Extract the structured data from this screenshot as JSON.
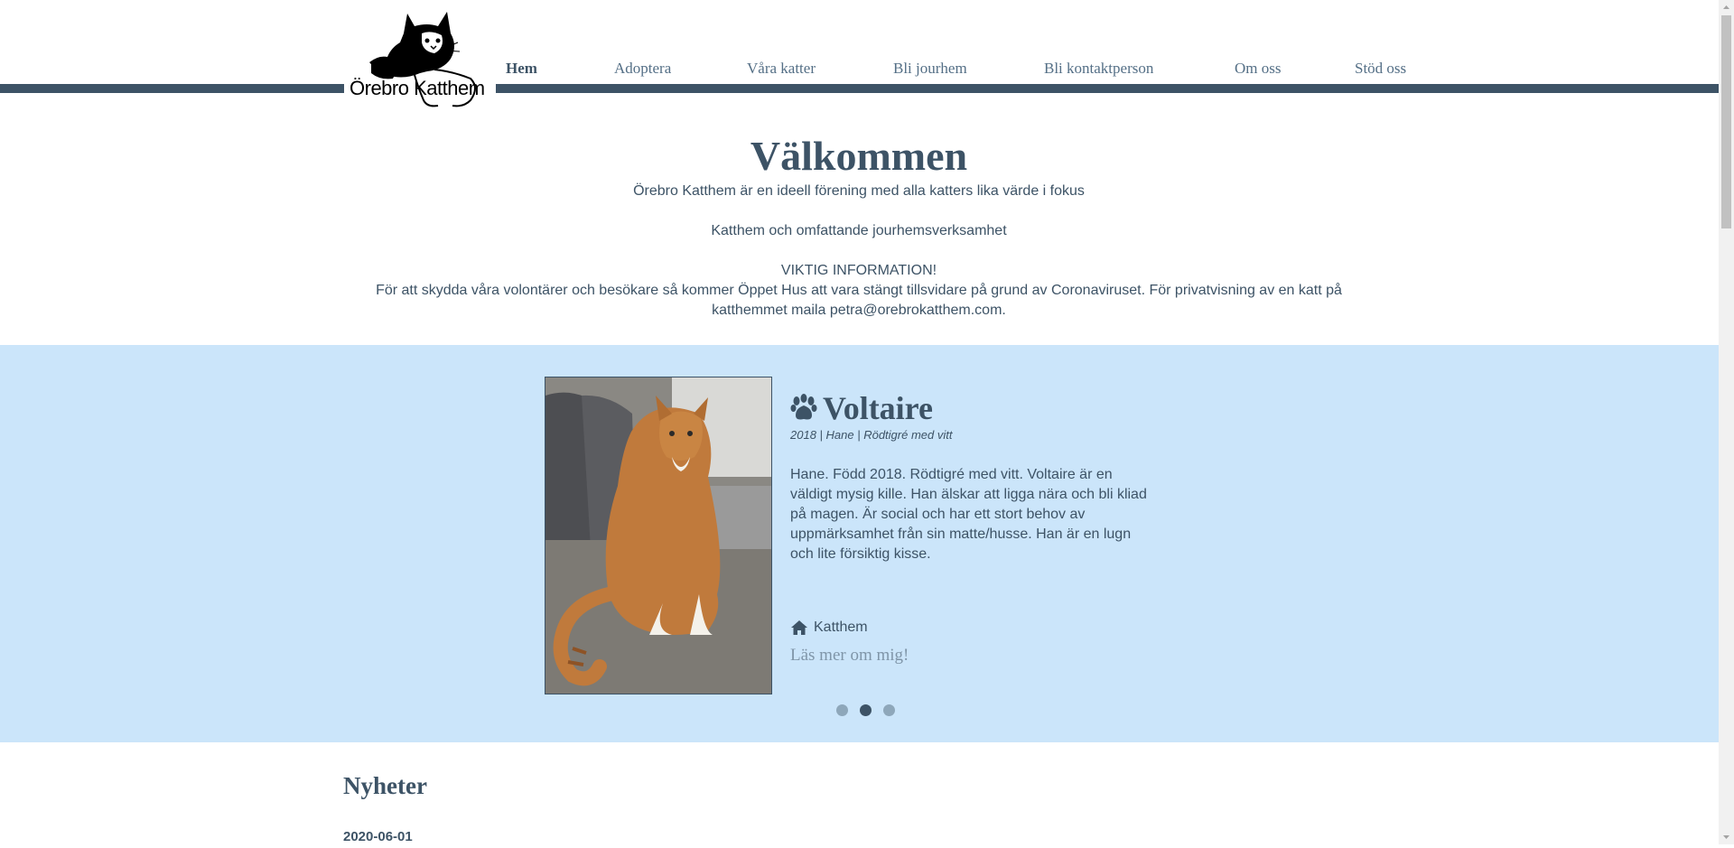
{
  "header": {
    "logo_text": "Örebro Katthem",
    "nav": [
      {
        "label": "Hem",
        "active": true
      },
      {
        "label": "Adoptera",
        "active": false
      },
      {
        "label": "Våra katter",
        "active": false
      },
      {
        "label": "Bli jourhem",
        "active": false
      },
      {
        "label": "Bli kontaktperson",
        "active": false
      },
      {
        "label": "Om oss",
        "active": false
      },
      {
        "label": "Stöd oss",
        "active": false
      }
    ]
  },
  "welcome": {
    "title": "Välkommen",
    "line1": "Örebro Katthem är en ideell förening med alla katters lika värde i fokus",
    "line2": "Katthem och omfattande jourhemsverksamhet",
    "line3": "VIKTIG INFORMATION!",
    "line4": "För att skydda våra volontärer och besökare så kommer Öppet Hus att vara stängt tillsvidare på grund av Coronaviruset. För privatvisning av en katt på katthemmet maila petra@orebrokatthem.com."
  },
  "slider": {
    "cat_name": "Voltaire",
    "cat_meta": "2018 | Hane | Rödtigré med vitt",
    "cat_description": "Hane. Född 2018. Rödtigré med vitt. Voltaire är en väldigt mysig kille. Han älskar att ligga nära och bli kliad på magen. Är social och har ett stort behov av uppmärksamhet från sin matte/husse. Han är en lugn och lite försiktig kisse.",
    "location": "Katthem",
    "read_more": "Läs mer om mig!",
    "dots": [
      false,
      true,
      false
    ]
  },
  "news": {
    "title": "Nyheter",
    "date": "2020-06-01"
  },
  "colors": {
    "primary": "#3d5366",
    "slider_bg": "#cbe5fa",
    "link_muted": "#7f95a8"
  },
  "icons": {
    "paw": "paw-icon",
    "home": "home-icon"
  }
}
